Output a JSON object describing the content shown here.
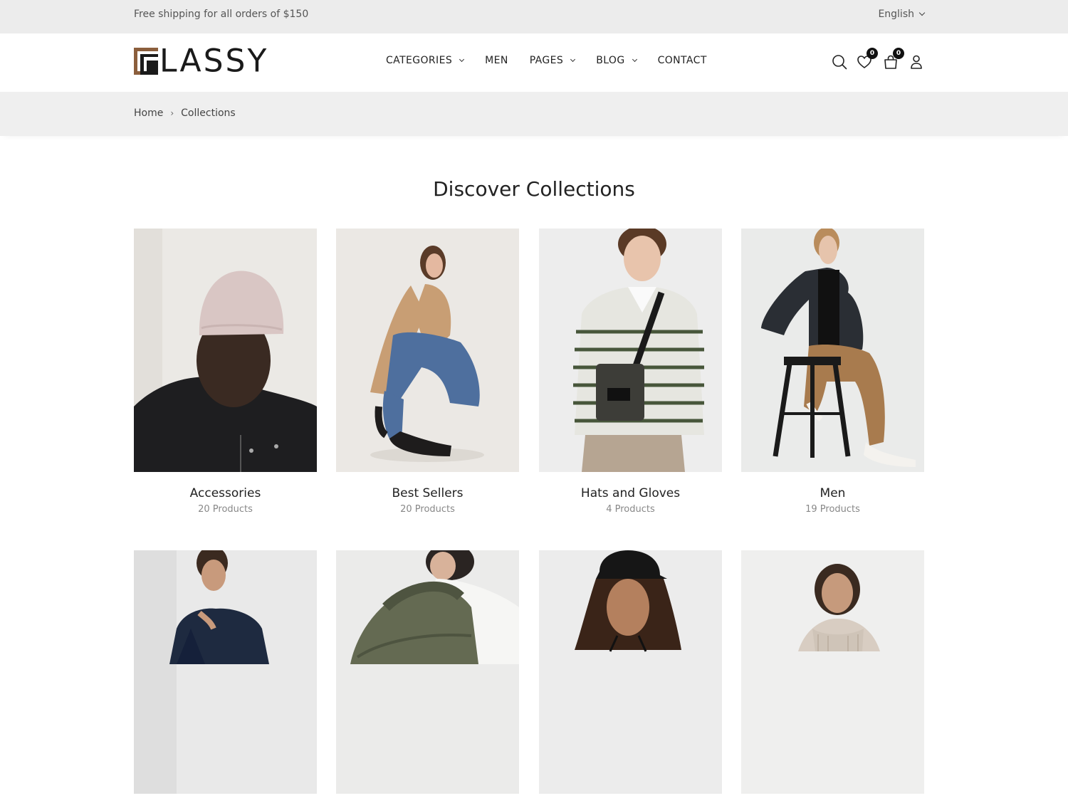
{
  "topbar": {
    "shipping_text": "Free shipping for all orders of $150",
    "language": "English"
  },
  "brand": {
    "logo_text": "LASSY",
    "colors": {
      "accent": "#8b5e3c",
      "dark": "#1a1a1a"
    }
  },
  "nav": {
    "items": [
      {
        "label": "CATEGORIES",
        "dropdown": true
      },
      {
        "label": "MEN",
        "dropdown": false
      },
      {
        "label": "PAGES",
        "dropdown": true
      },
      {
        "label": "BLOG",
        "dropdown": true
      },
      {
        "label": "CONTACT",
        "dropdown": false
      }
    ]
  },
  "header_icons": {
    "search": "search-icon",
    "wishlist": "heart-icon",
    "wishlist_count": "0",
    "cart": "bag-icon",
    "cart_count": "0",
    "account": "user-icon"
  },
  "breadcrumb": {
    "home": "Home",
    "separator": "›",
    "current": "Collections"
  },
  "page": {
    "title": "Discover Collections"
  },
  "collections": [
    {
      "name": "Accessories",
      "count": "20 Products"
    },
    {
      "name": "Best Sellers",
      "count": "20 Products"
    },
    {
      "name": "Hats and Gloves",
      "count": "4 Products"
    },
    {
      "name": "Men",
      "count": "19 Products"
    },
    {
      "name": "",
      "count": ""
    },
    {
      "name": "",
      "count": ""
    },
    {
      "name": "",
      "count": ""
    },
    {
      "name": "",
      "count": ""
    }
  ]
}
